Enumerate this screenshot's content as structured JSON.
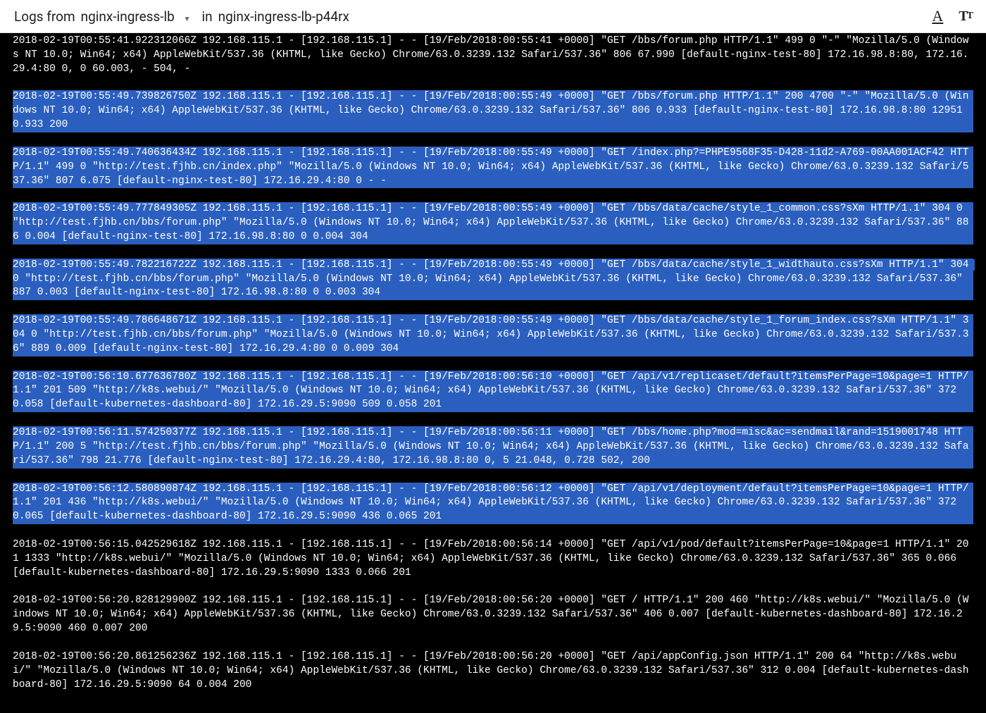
{
  "header": {
    "title_prefix": "Logs from ",
    "source": "nginx-ingress-lb",
    "in_label": " in ",
    "pod": "nginx-ingress-lb-p44rx"
  },
  "logs": [
    {
      "selected": false,
      "text": "2018-02-19T00:55:41.922312066Z 192.168.115.1 - [192.168.115.1] - - [19/Feb/2018:00:55:41 +0000] \"GET /bbs/forum.php HTTP/1.1\" 499 0 \"-\" \"Mozilla/5.0 (Windows NT 10.0; Win64; x64) AppleWebKit/537.36 (KHTML, like Gecko) Chrome/63.0.3239.132 Safari/537.36\" 806 67.990 [default-nginx-test-80] 172.16.98.8:80, 172.16.29.4:80 0, 0 60.003, - 504, -"
    },
    {
      "selected": true,
      "text": "2018-02-19T00:55:49.739826750Z 192.168.115.1 - [192.168.115.1] - - [19/Feb/2018:00:55:49 +0000] \"GET /bbs/forum.php HTTP/1.1\" 200 4700 \"-\" \"Mozilla/5.0 (Windows NT 10.0; Win64; x64) AppleWebKit/537.36 (KHTML, like Gecko) Chrome/63.0.3239.132 Safari/537.36\" 806 0.933 [default-nginx-test-80] 172.16.98.8:80 12951 0.933 200"
    },
    {
      "selected": true,
      "text": "2018-02-19T00:55:49.740636434Z 192.168.115.1 - [192.168.115.1] - - [19/Feb/2018:00:55:49 +0000] \"GET /index.php?=PHPE9568F35-D428-11d2-A769-00AA001ACF42 HTTP/1.1\" 499 0 \"http://test.fjhb.cn/index.php\" \"Mozilla/5.0 (Windows NT 10.0; Win64; x64) AppleWebKit/537.36 (KHTML, like Gecko) Chrome/63.0.3239.132 Safari/537.36\" 807 6.075 [default-nginx-test-80] 172.16.29.4:80 0 - -"
    },
    {
      "selected": true,
      "text": "2018-02-19T00:55:49.777849305Z 192.168.115.1 - [192.168.115.1] - - [19/Feb/2018:00:55:49 +0000] \"GET /bbs/data/cache/style_1_common.css?sXm HTTP/1.1\" 304 0 \"http://test.fjhb.cn/bbs/forum.php\" \"Mozilla/5.0 (Windows NT 10.0; Win64; x64) AppleWebKit/537.36 (KHTML, like Gecko) Chrome/63.0.3239.132 Safari/537.36\" 886 0.004 [default-nginx-test-80] 172.16.98.8:80 0 0.004 304"
    },
    {
      "selected": true,
      "text": "2018-02-19T00:55:49.782216722Z 192.168.115.1 - [192.168.115.1] - - [19/Feb/2018:00:55:49 +0000] \"GET /bbs/data/cache/style_1_widthauto.css?sXm HTTP/1.1\" 304 0 \"http://test.fjhb.cn/bbs/forum.php\" \"Mozilla/5.0 (Windows NT 10.0; Win64; x64) AppleWebKit/537.36 (KHTML, like Gecko) Chrome/63.0.3239.132 Safari/537.36\" 887 0.003 [default-nginx-test-80] 172.16.98.8:80 0 0.003 304"
    },
    {
      "selected": true,
      "text": "2018-02-19T00:55:49.786648671Z 192.168.115.1 - [192.168.115.1] - - [19/Feb/2018:00:55:49 +0000] \"GET /bbs/data/cache/style_1_forum_index.css?sXm HTTP/1.1\" 304 0 \"http://test.fjhb.cn/bbs/forum.php\" \"Mozilla/5.0 (Windows NT 10.0; Win64; x64) AppleWebKit/537.36 (KHTML, like Gecko) Chrome/63.0.3239.132 Safari/537.36\" 889 0.009 [default-nginx-test-80] 172.16.29.4:80 0 0.009 304"
    },
    {
      "selected": true,
      "text": "2018-02-19T00:56:10.677636780Z 192.168.115.1 - [192.168.115.1] - - [19/Feb/2018:00:56:10 +0000] \"GET /api/v1/replicaset/default?itemsPerPage=10&page=1 HTTP/1.1\" 201 509 \"http://k8s.webui/\" \"Mozilla/5.0 (Windows NT 10.0; Win64; x64) AppleWebKit/537.36 (KHTML, like Gecko) Chrome/63.0.3239.132 Safari/537.36\" 372 0.058 [default-kubernetes-dashboard-80] 172.16.29.5:9090 509 0.058 201"
    },
    {
      "selected": true,
      "text": "2018-02-19T00:56:11.574250377Z 192.168.115.1 - [192.168.115.1] - - [19/Feb/2018:00:56:11 +0000] \"GET /bbs/home.php?mod=misc&ac=sendmail&rand=1519001748 HTTP/1.1\" 200 5 \"http://test.fjhb.cn/bbs/forum.php\" \"Mozilla/5.0 (Windows NT 10.0; Win64; x64) AppleWebKit/537.36 (KHTML, like Gecko) Chrome/63.0.3239.132 Safari/537.36\" 798 21.776 [default-nginx-test-80] 172.16.29.4:80, 172.16.98.8:80 0, 5 21.048, 0.728 502, 200"
    },
    {
      "selected": true,
      "text": "2018-02-19T00:56:12.580890874Z 192.168.115.1 - [192.168.115.1] - - [19/Feb/2018:00:56:12 +0000] \"GET /api/v1/deployment/default?itemsPerPage=10&page=1 HTTP/1.1\" 201 436 \"http://k8s.webui/\" \"Mozilla/5.0 (Windows NT 10.0; Win64; x64) AppleWebKit/537.36 (KHTML, like Gecko) Chrome/63.0.3239.132 Safari/537.36\" 372 0.065 [default-kubernetes-dashboard-80] 172.16.29.5:9090 436 0.065 201"
    },
    {
      "selected": false,
      "text": "2018-02-19T00:56:15.042529618Z 192.168.115.1 - [192.168.115.1] - - [19/Feb/2018:00:56:14 +0000] \"GET /api/v1/pod/default?itemsPerPage=10&page=1 HTTP/1.1\" 201 1333 \"http://k8s.webui/\" \"Mozilla/5.0 (Windows NT 10.0; Win64; x64) AppleWebKit/537.36 (KHTML, like Gecko) Chrome/63.0.3239.132 Safari/537.36\" 365 0.066 [default-kubernetes-dashboard-80] 172.16.29.5:9090 1333 0.066 201"
    },
    {
      "selected": false,
      "text": "2018-02-19T00:56:20.828129900Z 192.168.115.1 - [192.168.115.1] - - [19/Feb/2018:00:56:20 +0000] \"GET / HTTP/1.1\" 200 460 \"http://k8s.webui/\" \"Mozilla/5.0 (Windows NT 10.0; Win64; x64) AppleWebKit/537.36 (KHTML, like Gecko) Chrome/63.0.3239.132 Safari/537.36\" 406 0.007 [default-kubernetes-dashboard-80] 172.16.29.5:9090 460 0.007 200"
    },
    {
      "selected": false,
      "text": "2018-02-19T00:56:20.861256236Z 192.168.115.1 - [192.168.115.1] - - [19/Feb/2018:00:56:20 +0000] \"GET /api/appConfig.json HTTP/1.1\" 200 64 \"http://k8s.webui/\" \"Mozilla/5.0 (Windows NT 10.0; Win64; x64) AppleWebKit/537.36 (KHTML, like Gecko) Chrome/63.0.3239.132 Safari/537.36\" 312 0.004 [default-kubernetes-dashboard-80] 172.16.29.5:9090 64 0.004 200"
    }
  ]
}
